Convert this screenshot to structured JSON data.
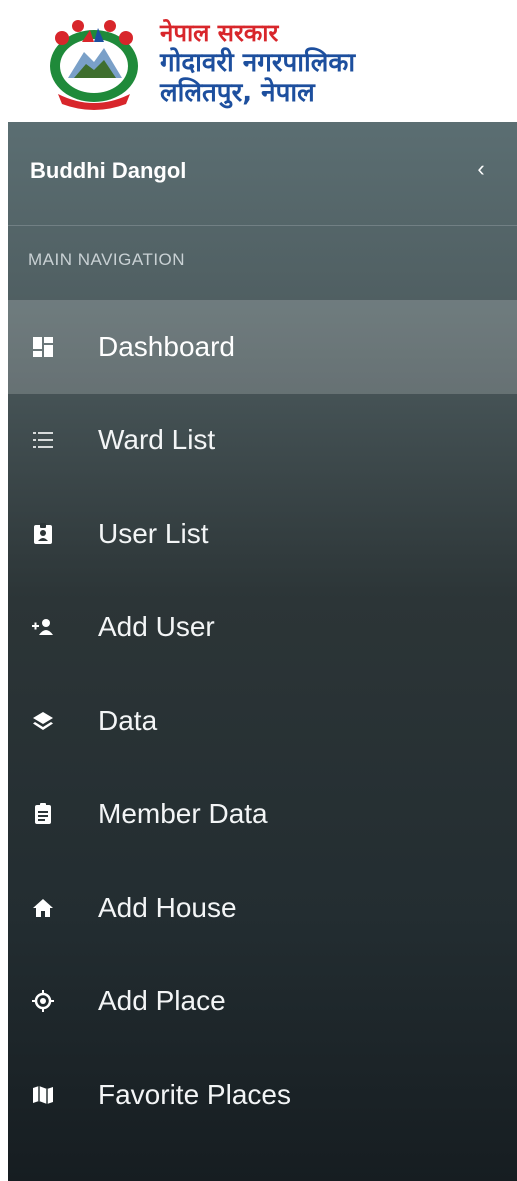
{
  "logo": {
    "line1": "नेपाल सरकार",
    "line2": "गोदावरी नगरपालिका",
    "line3": "ललितपुर, नेपाल"
  },
  "sidebar": {
    "user_name": "Buddhi Dangol",
    "collapse_symbol": "‹",
    "nav_header": "MAIN NAVIGATION",
    "items": [
      {
        "label": "Dashboard",
        "icon": "dashboard-icon",
        "active": true
      },
      {
        "label": "Ward List",
        "icon": "list-icon"
      },
      {
        "label": "User List",
        "icon": "id-badge-icon"
      },
      {
        "label": "Add User",
        "icon": "add-user-icon"
      },
      {
        "label": "Data",
        "icon": "layers-icon"
      },
      {
        "label": "Member Data",
        "icon": "clipboard-icon"
      },
      {
        "label": "Add House",
        "icon": "home-icon"
      },
      {
        "label": "Add Place",
        "icon": "crosshair-icon"
      },
      {
        "label": "Favorite Places",
        "icon": "map-icon"
      }
    ]
  },
  "colors": {
    "logo_red": "#d8262b",
    "logo_blue": "#1d4f9e",
    "sidebar_top": "#5b6e72",
    "sidebar_bottom": "#161d21"
  }
}
